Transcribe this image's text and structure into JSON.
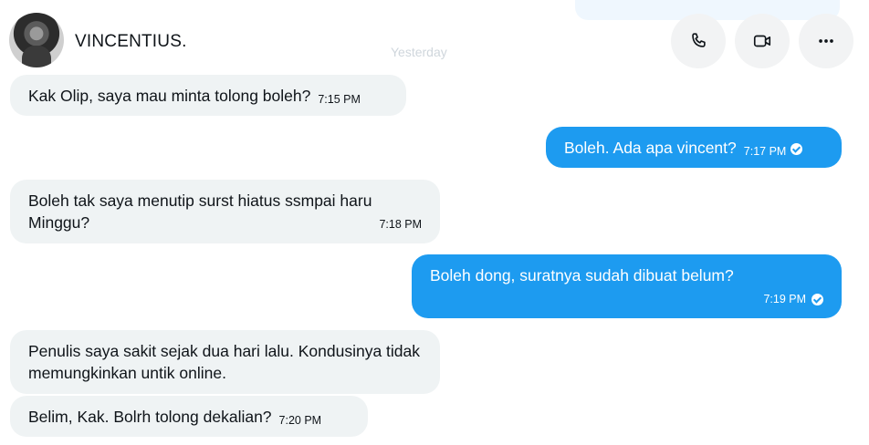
{
  "header": {
    "contact_name": "VINCENTIUS.",
    "date_separator": "Yesterday",
    "avatar_icon": "user-photo-avatar",
    "actions": [
      {
        "name": "call-button",
        "icon": "phone-icon"
      },
      {
        "name": "video-call-button",
        "icon": "video-camera-icon"
      },
      {
        "name": "more-options-button",
        "icon": "more-horizontal-icon"
      }
    ]
  },
  "messages": [
    {
      "direction": "incoming",
      "text": "Kak Olip, saya mau minta tolong boleh?",
      "time": "7:15 PM"
    },
    {
      "direction": "outgoing",
      "text": "Boleh. Ada apa vincent?",
      "time": "7:17 PM",
      "status": "read-check-icon"
    },
    {
      "direction": "incoming",
      "text": "Boleh tak saya menutip surst hiatus ssmpai haru Minggu?",
      "time": "7:18 PM"
    },
    {
      "direction": "outgoing",
      "text": "Boleh dong, suratnya sudah dibuat belum?",
      "time": "7:19 PM",
      "status": "read-check-icon"
    },
    {
      "direction": "incoming",
      "text": "Penulis saya sakit sejak dua hari lalu. Kondusinya tidak memungkinkan untik online.",
      "time": ""
    },
    {
      "direction": "incoming",
      "text": "Belim, Kak. Bolrh tolong dekalian?",
      "time": "7:20 PM"
    }
  ],
  "colors": {
    "outgoing_bubble": "#1d9bf0",
    "incoming_bubble": "#eff3f4",
    "action_button_bg": "#f2f3f4",
    "text": "#0f1419"
  }
}
